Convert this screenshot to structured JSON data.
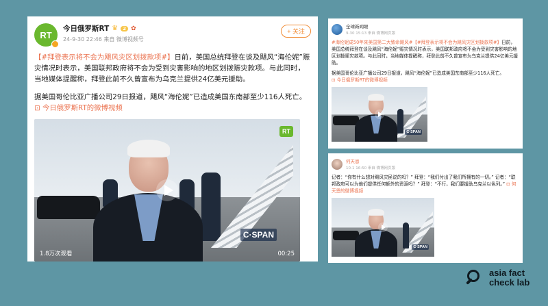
{
  "main_post": {
    "account_name": "今日俄罗斯RT",
    "avatar_text": "RT",
    "vip_badge": "2",
    "timestamp": "24-9-30 22:46",
    "source": "来自 微博视频号",
    "follow_label": "+ 关注",
    "hashtag": "【#拜登表示将不会为飓风灾区划拨款项#】",
    "text_1": "日前，美国总统拜登在谈及飓风“海伦妮”赈灾情况时表示，美国联邦政府将不会为受到灾害影响的地区划拨赈灾款项。与此同时，当地媒体提醒称，拜登此前不久曾宣布为乌克兰提供24亿美元援助。",
    "text_2": "据美国哥伦比亚广播公司29日报道，飓风“海伦妮”已造成美国东南部至少116人死亡。",
    "video_link": "今日俄罗斯RT的微博视频",
    "video": {
      "logo": "RT",
      "watermark": "C·SPAN",
      "views": "1.8万次观看",
      "duration": "00:25"
    }
  },
  "post_top_right": {
    "account_name": "全球新闻眼",
    "meta": "9-30 15:13 来自 微博网页版",
    "hashtag": "#海伦妮成50年来美国第二大致命飓风#【#拜登表示将不会为飓风灾区划拨款项#】",
    "text_1": "日前，美国总统拜登在谈及飓风“海伦妮”赈灾情况时表示，美国联邦政府将不会为受到灾害影响的地区划拨赈灾款项。与此同时，当地媒体提醒称，拜登此前不久曾宣布为乌克兰提供24亿美元援助。",
    "text_2": "据美国哥伦比亚广播公司29日报道，飓风“海伦妮”已造成美国东南部至少116人死亡。",
    "video_link": "今日俄罗斯RT的微博视频",
    "watermark": "C·SPAN"
  },
  "post_bottom_right": {
    "account_name": "何天恩",
    "meta": "10-1 16:50 来自 微博网页版",
    "text_1": "记者：“你有什么想对飓风灾民说的吗？” 拜登：“我们付出了我们所拥有的一切。” 记者：“联邦政府可以为他们提供任何额外的资源吗？” 拜登：“不行，我们要援助乌克兰以色列。”",
    "video_link": "何天恩的微博视频",
    "watermark": "C·SPAN"
  },
  "branding": {
    "line1": "asia fact",
    "line2": "check lab"
  },
  "colors": {
    "background": "#5e96a4",
    "accent": "#eb7350",
    "rt_green": "#6ab82e"
  }
}
